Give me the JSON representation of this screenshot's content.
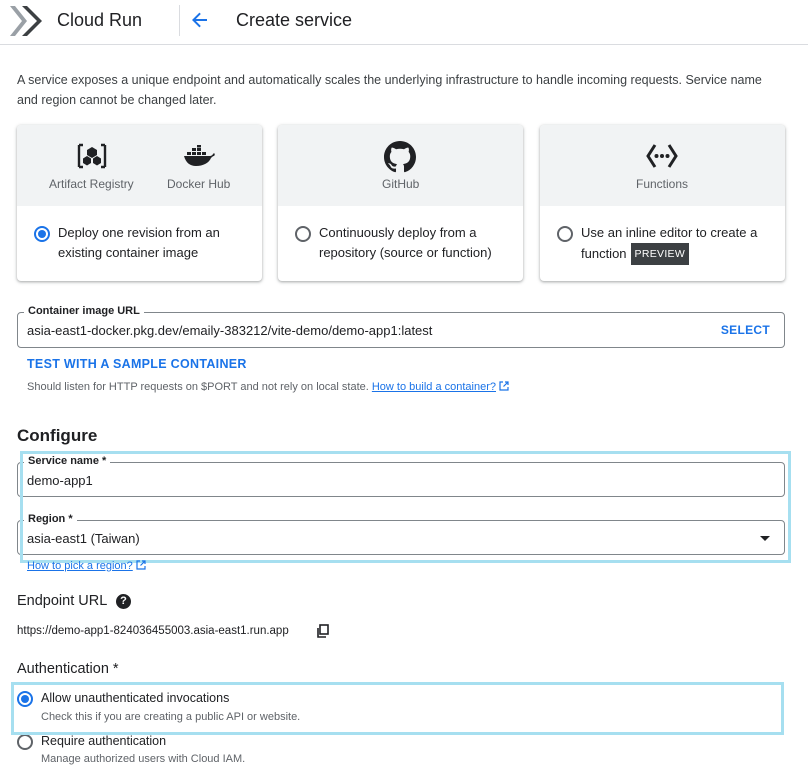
{
  "header": {
    "app_title": "Cloud Run",
    "page_title": "Create service"
  },
  "intro": "A service exposes a unique endpoint and automatically scales the underlying infrastructure to handle incoming requests. Service name and region cannot be changed later.",
  "deploy_options": [
    {
      "icons": [
        "Artifact Registry",
        "Docker Hub"
      ],
      "text": "Deploy one revision from an existing container image",
      "selected": true
    },
    {
      "icons": [
        "GitHub"
      ],
      "text": "Continuously deploy from a repository (source or function)",
      "selected": false
    },
    {
      "icons": [
        "Functions"
      ],
      "text": "Use an inline editor to create a function",
      "badge": "PREVIEW",
      "selected": false
    }
  ],
  "container": {
    "label": "Container image URL",
    "value": "asia-east1-docker.pkg.dev/emaily-383212/vite-demo/demo-app1:latest",
    "select_label": "SELECT",
    "test_link": "TEST WITH A SAMPLE CONTAINER",
    "hint": "Should listen for HTTP requests on $PORT and not rely on local state.",
    "hint_link": "How to build a container?"
  },
  "configure": {
    "title": "Configure",
    "service_name_label": "Service name *",
    "service_name_value": "demo-app1",
    "region_label": "Region *",
    "region_value": "asia-east1 (Taiwan)",
    "region_link": "How to pick a region?"
  },
  "endpoint": {
    "title": "Endpoint URL",
    "help_glyph": "?",
    "url": "https://demo-app1-824036455003.asia-east1.run.app"
  },
  "authentication": {
    "title": "Authentication *",
    "options": [
      {
        "label": "Allow unauthenticated invocations",
        "sub": "Check this if you are creating a public API or website.",
        "selected": true
      },
      {
        "label": "Require authentication",
        "sub": "Manage authorized users with Cloud IAM.",
        "selected": false
      }
    ]
  },
  "colors": {
    "accent": "#1a73e8",
    "highlight": "#a6dff0",
    "card_bg": "#f1f3f4"
  }
}
